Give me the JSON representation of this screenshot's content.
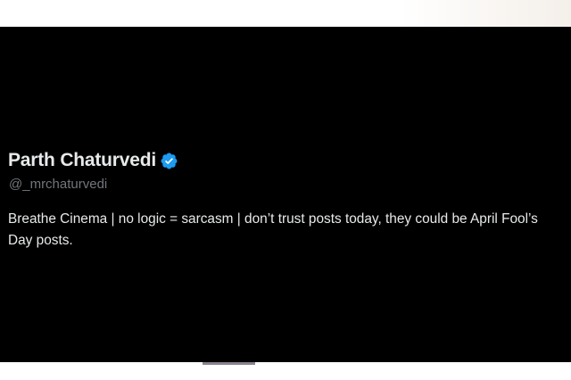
{
  "profile": {
    "display_name": "Parth Chaturvedi",
    "handle": "@_mrchaturvedi",
    "bio": "Breathe Cinema | no logic = sarcasm | don’t trust posts today, they could be April Fool’s Day posts.",
    "verified_icon": "verified-badge-icon",
    "verified_color": "#1d9bf0"
  },
  "colors": {
    "card_background": "#000000",
    "primary_text": "#e7e9ea",
    "secondary_text": "#71767b"
  }
}
